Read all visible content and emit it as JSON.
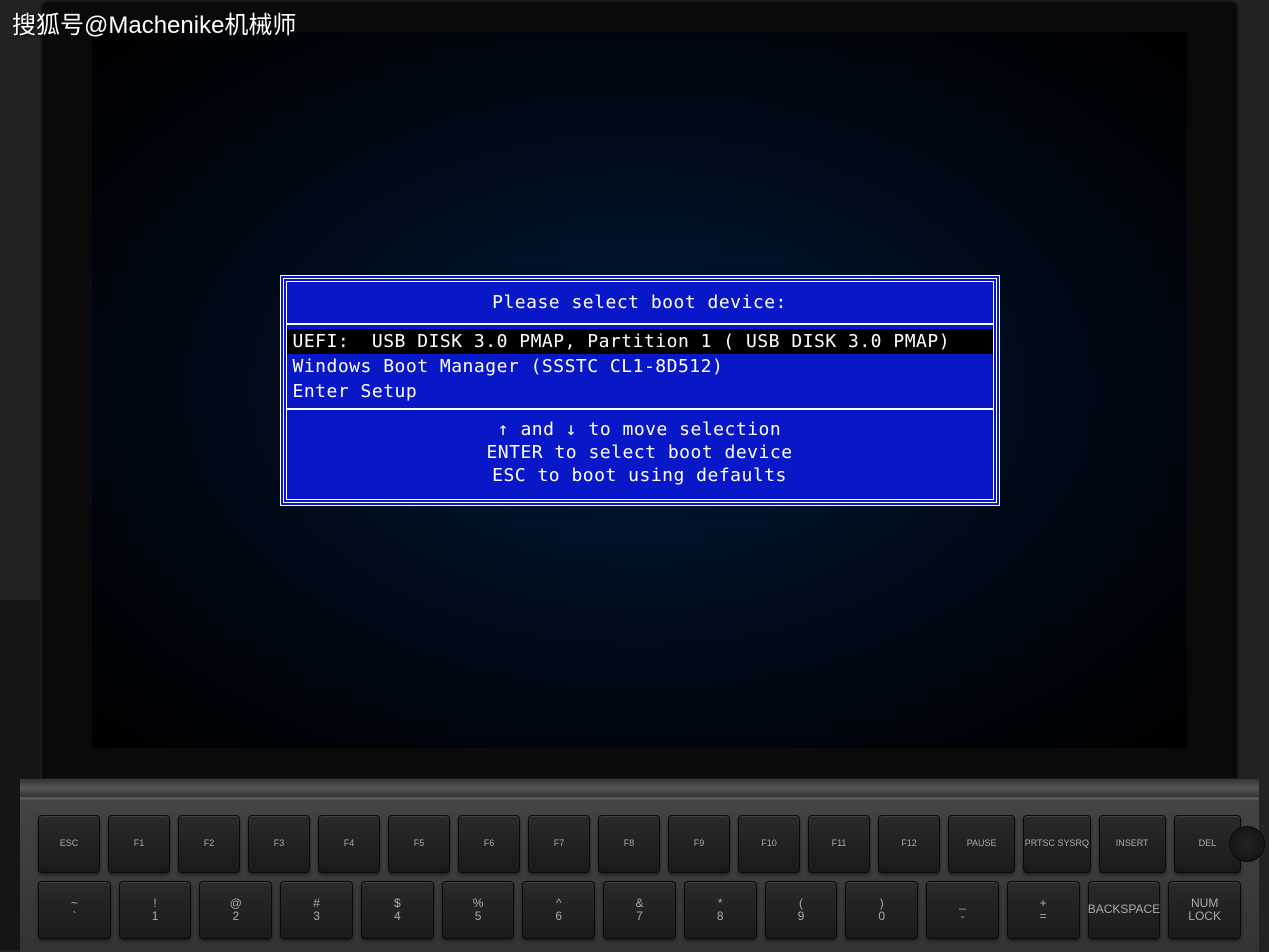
{
  "watermark": "搜狐号@Machenike机械师",
  "bios": {
    "title": "Please select boot device:",
    "options": [
      {
        "label": "UEFI:  USB DISK 3.0 PMAP, Partition 1 ( USB DISK 3.0 PMAP)",
        "selected": true
      },
      {
        "label": "Windows Boot Manager (SSSTC CL1-8D512)",
        "selected": false
      },
      {
        "label": "Enter Setup",
        "selected": false
      }
    ],
    "instructions": {
      "line1": "↑ and ↓ to move selection",
      "line2": "ENTER to select boot device",
      "line3": "ESC to boot using defaults"
    }
  },
  "keyboard": {
    "row1": [
      "ESC",
      "F1",
      "F2",
      "F3",
      "F4",
      "F5",
      "F6",
      "F7",
      "F8",
      "F9",
      "F10",
      "F11",
      "F12",
      "PAUSE",
      "PRTSC SYSRQ",
      "INSERT",
      "DEL"
    ],
    "row2": [
      {
        "top": "~",
        "main": "`"
      },
      {
        "top": "!",
        "main": "1"
      },
      {
        "top": "@",
        "main": "2"
      },
      {
        "top": "#",
        "main": "3"
      },
      {
        "top": "$",
        "main": "4"
      },
      {
        "top": "%",
        "main": "5"
      },
      {
        "top": "^",
        "main": "6"
      },
      {
        "top": "&",
        "main": "7"
      },
      {
        "top": "*",
        "main": "8"
      },
      {
        "top": "(",
        "main": "9"
      },
      {
        "top": ")",
        "main": "0"
      },
      {
        "top": "_",
        "main": "-"
      },
      {
        "top": "+",
        "main": "="
      },
      {
        "top": "",
        "main": "BACKSPACE"
      },
      {
        "top": "NUM",
        "main": "LOCK"
      }
    ]
  }
}
